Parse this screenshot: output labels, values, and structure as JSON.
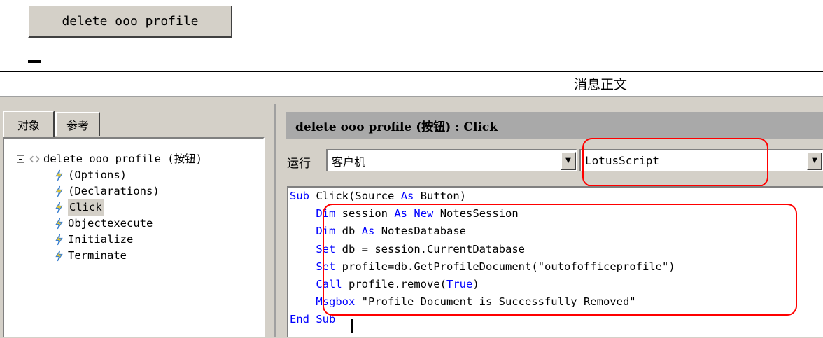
{
  "button": {
    "label": "delete ooo profile"
  },
  "message_header": {
    "title": "消息正文"
  },
  "left_panel": {
    "tabs": [
      {
        "label": "对象",
        "active": true
      },
      {
        "label": "参考",
        "active": false
      }
    ],
    "tree": {
      "root": {
        "label": "delete ooo profile (按钮)",
        "icon": "button-object-icon",
        "expanded": true
      },
      "children": [
        {
          "label": "(Options)",
          "icon": "lotusscript-event-icon"
        },
        {
          "label": "(Declarations)",
          "icon": "lotusscript-event-icon"
        },
        {
          "label": "Click",
          "icon": "lotusscript-event-icon",
          "selected": true
        },
        {
          "label": "Objectexecute",
          "icon": "lotusscript-event-icon"
        },
        {
          "label": "Initialize",
          "icon": "lotusscript-event-icon"
        },
        {
          "label": "Terminate",
          "icon": "lotusscript-event-icon"
        }
      ]
    }
  },
  "editor": {
    "event_title": "delete ooo profile (按钮) : Click",
    "run_label": "运行",
    "run_target": "客户机",
    "language": "LotusScript",
    "code_lines": [
      "Sub Click(Source As Button)",
      "    Dim session As New NotesSession",
      "    Dim db As NotesDatabase",
      "    Set db = session.CurrentDatabase",
      "    Set profile=db.GetProfileDocument(\"outofofficeprofile\")",
      "    Call profile.remove(True)",
      "    Msgbox \"Profile Document is Successfully Removed\"",
      "End Sub"
    ]
  },
  "colors": {
    "annotation": "#ff0000",
    "keyword": "#0000ff",
    "panel": "#d4d0c8",
    "event_bar": "#a9a9a9"
  }
}
